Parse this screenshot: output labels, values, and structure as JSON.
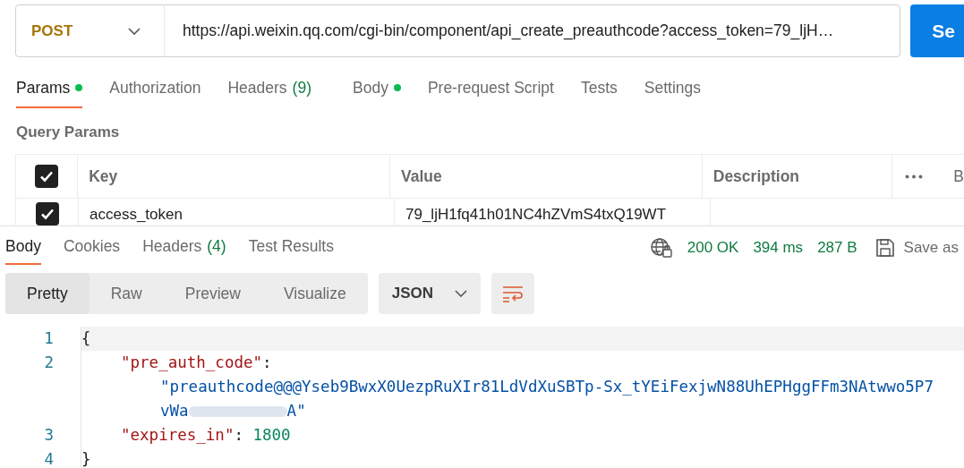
{
  "request": {
    "method": "POST",
    "url": "https://api.weixin.qq.com/cgi-bin/component/api_create_preauthcode?access_token=79_ljH…",
    "send_label": "Se"
  },
  "request_tabs": [
    {
      "label": "Params",
      "dot": true,
      "selected": true
    },
    {
      "label": "Authorization",
      "dot": false,
      "selected": false
    },
    {
      "label": "Headers",
      "count": "(9)",
      "dot": false,
      "selected": false
    },
    {
      "label": "Body",
      "dot": true,
      "selected": false
    },
    {
      "label": "Pre-request Script",
      "dot": false,
      "selected": false
    },
    {
      "label": "Tests",
      "dot": false,
      "selected": false
    },
    {
      "label": "Settings",
      "dot": false,
      "selected": false
    }
  ],
  "query_params": {
    "title": "Query Params",
    "header_checked": true,
    "columns": [
      "Key",
      "Value",
      "Description"
    ],
    "bulk_label": "B",
    "rows": [
      {
        "checked": true,
        "key": "access_token",
        "value": "79_ljH1fq41h01NC4hZVmS4txQ19WT"
      }
    ]
  },
  "response_tabs": [
    {
      "label": "Body",
      "selected": true
    },
    {
      "label": "Cookies",
      "selected": false
    },
    {
      "label": "Headers",
      "count": "(4)",
      "selected": false
    },
    {
      "label": "Test Results",
      "selected": false
    }
  ],
  "status": {
    "code": "200 OK",
    "time": "394 ms",
    "size": "287 B",
    "save_label": "Save as"
  },
  "view_modes": [
    {
      "label": "Pretty",
      "selected": true
    },
    {
      "label": "Raw",
      "selected": false
    },
    {
      "label": "Preview",
      "selected": false
    },
    {
      "label": "Visualize",
      "selected": false
    }
  ],
  "format": "JSON",
  "code_lines": [
    {
      "number": "1",
      "parts": [
        {
          "kind": "punct",
          "text": "{"
        }
      ]
    },
    {
      "number": "2",
      "parts": [
        {
          "kind": "key",
          "text": "\"pre_auth_code\""
        },
        {
          "kind": "punct",
          "text": ":"
        }
      ],
      "continuation": [
        "\"preauthcode@@@Yseb9BwxX0UezpRuXIr81LdVdXuSBTp-Sx_tYEiFexjwN88UhEPHggFFm3NAtwwo5P7",
        "vWa",
        "A\""
      ]
    },
    {
      "number": "3",
      "parts": [
        {
          "kind": "key",
          "text": "\"expires_in\""
        },
        {
          "kind": "punct",
          "text": ": "
        },
        {
          "kind": "number",
          "text": "1800"
        }
      ]
    },
    {
      "number": "4",
      "parts": [
        {
          "kind": "punct",
          "text": "}"
        }
      ]
    }
  ]
}
